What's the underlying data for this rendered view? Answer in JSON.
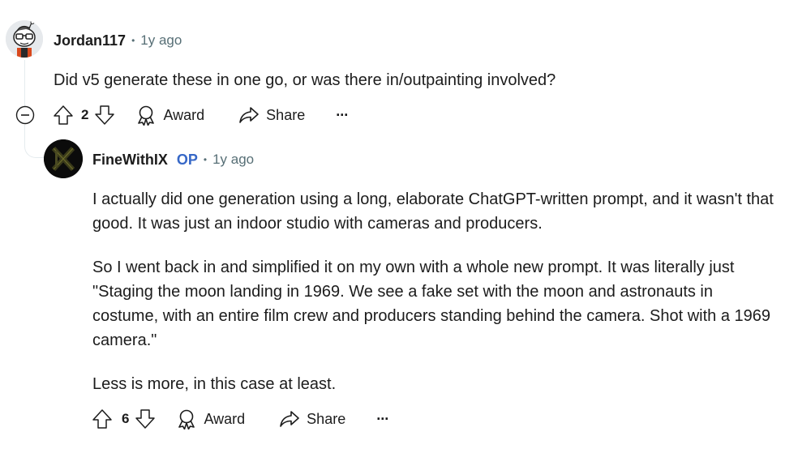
{
  "comment1": {
    "username": "Jordan117",
    "separator": "•",
    "time": "1y ago",
    "text": "Did v5 generate these in one go, or was there in/outpainting involved?",
    "score": "2",
    "award_label": "Award",
    "share_label": "Share",
    "more_label": "···"
  },
  "comment2": {
    "username": "FineWithIX",
    "op_badge": "OP",
    "separator": "•",
    "time": "1y ago",
    "paragraphs": [
      "I actually did one generation using a long, elaborate ChatGPT-written prompt, and it wasn't that good. It was just an indoor studio with cameras and producers.",
      "So I went back in and simplified it on my own with a whole new prompt. It was literally just \"Staging the moon landing in 1969. We see a fake set with the moon and astronauts in costume, with an entire film crew and producers standing behind the camera. Shot with a 1969 camera.\"",
      "Less is more, in this case at least."
    ],
    "score": "6",
    "award_label": "Award",
    "share_label": "Share",
    "more_label": "···"
  },
  "colors": {
    "text": "#1c1c1c",
    "meta": "#576f76",
    "op": "#3768c7",
    "thread": "#e5ebee"
  }
}
